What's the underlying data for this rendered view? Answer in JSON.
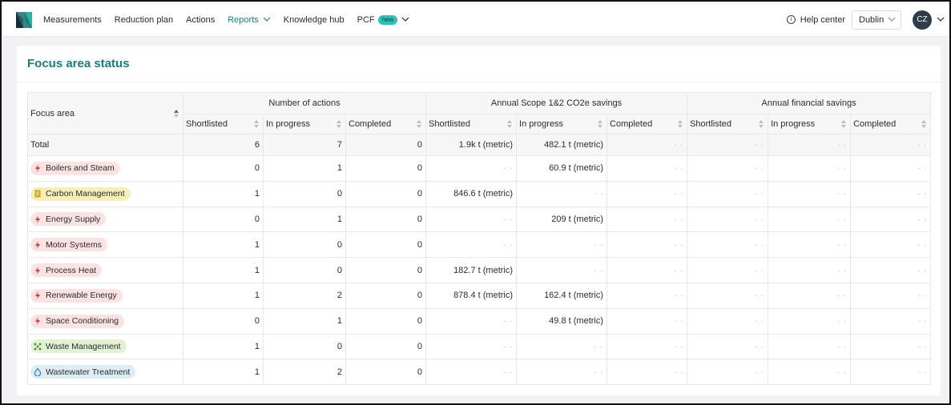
{
  "nav": {
    "items": [
      {
        "label": "Measurements",
        "active": false,
        "chevron": false
      },
      {
        "label": "Reduction plan",
        "active": false,
        "chevron": false
      },
      {
        "label": "Actions",
        "active": false,
        "chevron": false
      },
      {
        "label": "Reports",
        "active": true,
        "chevron": true
      },
      {
        "label": "Knowledge hub",
        "active": false,
        "chevron": false
      }
    ],
    "pcf_label": "PCF",
    "pcf_badge": "new",
    "help_label": "Help center",
    "site": "Dublin",
    "avatar_initials": "CZ"
  },
  "page": {
    "title": "Focus area status"
  },
  "table": {
    "first_header": "Focus area",
    "groups": [
      "Number of actions",
      "Annual Scope 1&2 CO2e savings",
      "Annual financial savings"
    ],
    "subheaders": [
      "Shortlisted",
      "In progress",
      "Completed",
      "Shortlisted",
      "In progress",
      "Completed",
      "Shortlisted",
      "In progress",
      "Completed"
    ],
    "dash": "- -",
    "total": {
      "label": "Total",
      "cells": [
        "6",
        "7",
        "0",
        "1.9k t (metric)",
        "482.1 t (metric)",
        "- -",
        "- -",
        "- -",
        "- -"
      ]
    },
    "rows": [
      {
        "label": "Boilers and Steam",
        "color": "#fbe3e3",
        "icon": "lightning-icon",
        "cells": [
          "0",
          "1",
          "0",
          "- -",
          "60.9 t (metric)",
          "- -",
          "- -",
          "- -",
          "- -"
        ]
      },
      {
        "label": "Carbon Management",
        "color": "#f6efb8",
        "icon": "document-icon",
        "cells": [
          "1",
          "0",
          "0",
          "846.6 t (metric)",
          "- -",
          "- -",
          "- -",
          "- -",
          "- -"
        ]
      },
      {
        "label": "Energy Supply",
        "color": "#fbe3e3",
        "icon": "lightning-icon",
        "cells": [
          "0",
          "1",
          "0",
          "- -",
          "209 t (metric)",
          "- -",
          "- -",
          "- -",
          "- -"
        ]
      },
      {
        "label": "Motor Systems",
        "color": "#fbe3e3",
        "icon": "lightning-icon",
        "cells": [
          "1",
          "0",
          "0",
          "- -",
          "- -",
          "- -",
          "- -",
          "- -",
          "- -"
        ]
      },
      {
        "label": "Process Heat",
        "color": "#fbe3e3",
        "icon": "lightning-icon",
        "cells": [
          "1",
          "0",
          "0",
          "182.7 t (metric)",
          "- -",
          "- -",
          "- -",
          "- -",
          "- -"
        ]
      },
      {
        "label": "Renewable Energy",
        "color": "#fbe3e3",
        "icon": "lightning-icon",
        "cells": [
          "1",
          "2",
          "0",
          "878.4 t (metric)",
          "162.4 t (metric)",
          "- -",
          "- -",
          "- -",
          "- -"
        ]
      },
      {
        "label": "Space Conditioning",
        "color": "#fbe3e3",
        "icon": "lightning-icon",
        "cells": [
          "0",
          "1",
          "0",
          "- -",
          "49.8 t (metric)",
          "- -",
          "- -",
          "- -",
          "- -"
        ]
      },
      {
        "label": "Waste Management",
        "color": "#e2f2d3",
        "icon": "recycle-icon",
        "cells": [
          "1",
          "0",
          "0",
          "- -",
          "- -",
          "- -",
          "- -",
          "- -",
          "- -"
        ]
      },
      {
        "label": "Wastewater Treatment",
        "color": "#dcecf8",
        "icon": "droplet-icon",
        "cells": [
          "1",
          "2",
          "0",
          "- -",
          "- -",
          "- -",
          "- -",
          "- -",
          "- -"
        ]
      }
    ]
  }
}
